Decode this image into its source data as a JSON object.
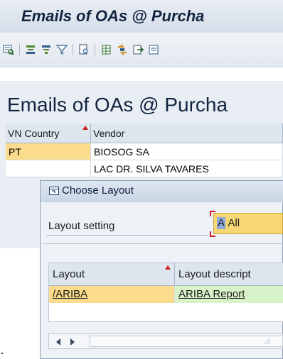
{
  "app": {
    "title": "Emails of OAs @ Purcha"
  },
  "toolbar": {
    "icons": [
      "details-icon",
      "sort-ascending-icon",
      "sort-descending-icon",
      "filter-icon",
      "print-preview-icon",
      "spreadsheet-export-icon",
      "layout-change-icon",
      "export-file-icon",
      "word-processing-icon"
    ]
  },
  "report": {
    "title": "Emails of OAs @ Purcha",
    "columns": [
      "VN Country",
      "Vendor"
    ],
    "rows": [
      {
        "country": "PT",
        "vendor": "BIOSOG SA"
      },
      {
        "country": "",
        "vendor": "LAC DR. SILVA TAVARES"
      }
    ]
  },
  "dialog": {
    "title": "Choose Layout",
    "layout_setting_label": "Layout setting",
    "layout_setting_value_sel": "A",
    "layout_setting_value_rest": " All",
    "table": {
      "columns": [
        "Layout",
        "Layout descript"
      ],
      "rows": [
        {
          "layout": "/ARIBA",
          "description": "ARIBA Report"
        }
      ]
    }
  },
  "colors": {
    "title_bg": "#d5dde8",
    "selection_yellow": "#f7d774",
    "description_green": "#d8f3c9",
    "sort_marker_red": "#d02020"
  }
}
